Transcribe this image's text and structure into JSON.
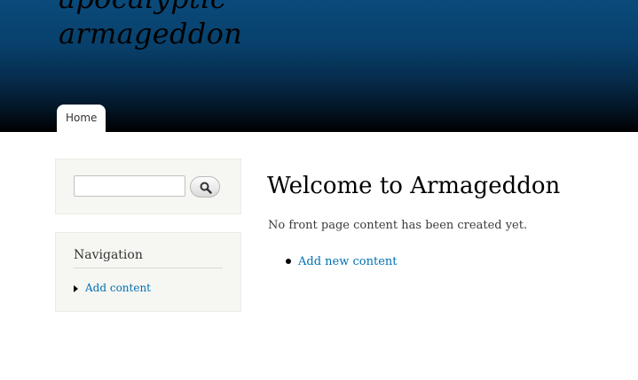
{
  "header": {
    "site_name_line1": "apocalyptic",
    "site_name_line2": "armageddon",
    "menu": [
      {
        "label": "Home"
      }
    ]
  },
  "sidebar": {
    "search": {
      "value": "",
      "placeholder": "",
      "button_icon": "search-icon"
    },
    "navigation": {
      "title": "Navigation",
      "items": [
        {
          "label": "Add content"
        }
      ]
    }
  },
  "main": {
    "title": "Welcome to Armageddon",
    "empty_text": "No front page content has been created yet.",
    "links": [
      {
        "label": "Add new content"
      }
    ]
  },
  "colors": {
    "link": "#0071b3",
    "header_top": "#0a4a7a",
    "header_bottom": "#000000",
    "sidebar_bg": "#f6f6f2"
  }
}
